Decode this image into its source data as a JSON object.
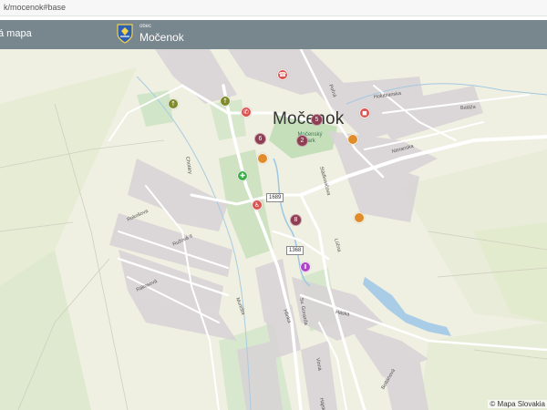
{
  "browser": {
    "url": "k/mocenok#base"
  },
  "header": {
    "menu_label": "á mapa",
    "municipality_kind": "obec",
    "municipality_name": "Močenok"
  },
  "map": {
    "town_label": "Močenok",
    "park_label": "Močenský park",
    "road_numbers": [
      "1689",
      "1368"
    ],
    "street_labels": [
      "Poľná",
      "Holubianska",
      "Baláža",
      "Nitrianska",
      "Sládkovičova",
      "Chotáry",
      "Rokošova",
      "Ružová II",
      "Rákosová",
      "Murtišta",
      "Hlinka",
      "Sv. Gorazda",
      "Háska",
      "Vinná",
      "Lúčna",
      "Bottanová",
      "Hájska"
    ],
    "cluster_counts": [
      "5",
      "6",
      "2",
      "8"
    ],
    "marker_symbols": [
      "✆",
      "↑",
      "↑",
      "✚",
      "♿",
      "Ⅱ",
      "☎",
      "◼"
    ],
    "attribution": "© Mapa Slovakia"
  }
}
